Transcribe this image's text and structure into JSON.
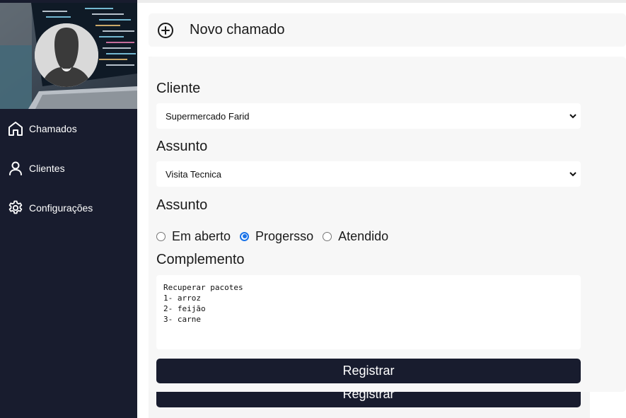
{
  "sidebar": {
    "items": [
      {
        "label": "Chamados",
        "icon": "home-icon"
      },
      {
        "label": "Clientes",
        "icon": "user-icon"
      },
      {
        "label": "Configurações",
        "icon": "gear-icon"
      }
    ]
  },
  "header": {
    "title": "Novo chamado",
    "icon": "plus-circle-icon"
  },
  "form": {
    "cliente_label": "Cliente",
    "cliente_value": "Supermercado Farid",
    "assunto_label": "Assunto",
    "assunto_value": "Visita Tecnica",
    "status_label": "Assunto",
    "status_options": [
      {
        "label": "Em aberto",
        "checked": false
      },
      {
        "label": "Progersso",
        "checked": true
      },
      {
        "label": "Atendido",
        "checked": false
      }
    ],
    "complemento_label": "Complemento",
    "complemento_value": "Recuperar pacotes\n1- arroz\n2- feijão\n3- carne",
    "submit_label": "Registrar"
  },
  "ghost": {
    "submit_label": "Registrar"
  },
  "colors": {
    "sidebar_bg": "#181c2e",
    "card_bg": "#f7f7f7",
    "button_bg": "#181c2e",
    "radio_accent": "#1a73e8"
  }
}
